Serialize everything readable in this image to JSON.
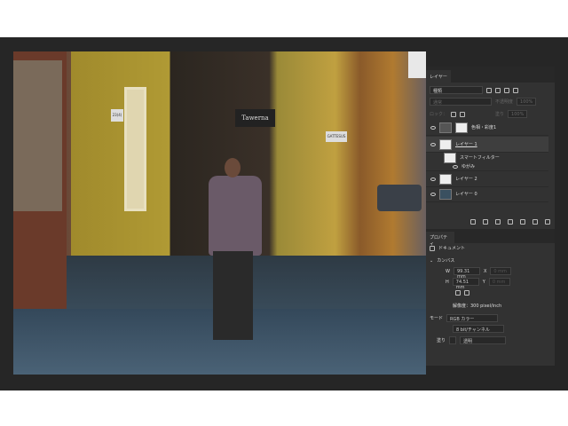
{
  "photo": {
    "sign1": "Tawerna",
    "sign2": "GATTESUS",
    "number": "23(4)"
  },
  "layers_panel": {
    "tab": "レイヤー",
    "filter": "種類",
    "blend": "通常",
    "opacity_label": "不透明度",
    "opacity": "100%",
    "lock_label": "ロック：",
    "fill_label": "塗り",
    "fill": "100%",
    "layers": [
      {
        "name": "色相・彩度1"
      },
      {
        "name": "レイヤー 1"
      },
      {
        "name": "スマートフィルター"
      },
      {
        "name": "ゆがみ"
      },
      {
        "name": "レイヤー 2"
      },
      {
        "name": "レイヤー 0"
      }
    ]
  },
  "properties_panel": {
    "tab": "プロパティ",
    "doc_label": "ドキュメント",
    "section": "カンバス",
    "w_label": "W",
    "w": "99.31 mm",
    "h_label": "H",
    "h": "74.51 mm",
    "x_label": "X",
    "y_label": "Y",
    "x": "0 mm",
    "y": "0 mm",
    "resolution": "解像度：300 pixel/inch",
    "mode_label": "モード",
    "mode": "RGB カラー",
    "depth": "8 bit/チャンネル",
    "fill_label": "塗り",
    "fill": "透明"
  }
}
